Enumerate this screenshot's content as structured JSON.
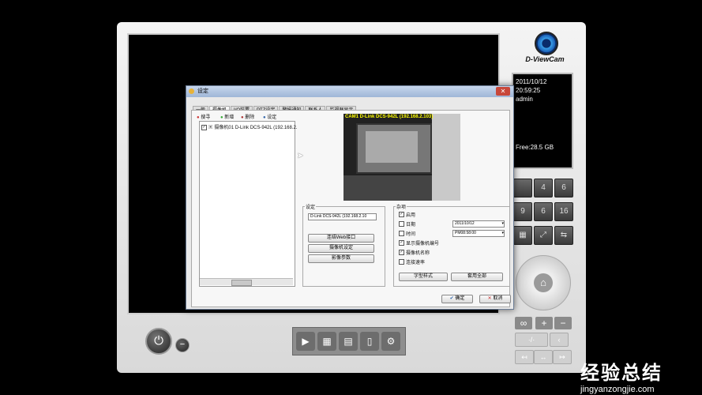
{
  "app": {
    "logo_text": "D-ViewCam",
    "info": {
      "date": "2011/10/12",
      "time": "20:59:25",
      "user": "admin",
      "free": "Free:28.5 GB"
    },
    "grid_buttons": [
      "4",
      "6",
      "9",
      "6",
      "16"
    ]
  },
  "dialog": {
    "title": "设定",
    "close": "✕",
    "tabs": [
      "一般",
      "摄像机",
      "I/O装置",
      "PTZ设定",
      "警报通知",
      "联系人",
      "监视器显示"
    ],
    "toolbar": [
      "搜寻",
      "新增",
      "删除",
      "设定"
    ],
    "camera_item": "摄像机01 D-Link DCS-942L (192.168.2.",
    "video_caption": "CAM1 D-Link DCS-942L (192.168.2.103)",
    "settings": {
      "legend": "设定",
      "device_value": "D-Link DCS-942L (192.168.2.10",
      "buttons": [
        "连结Web接口",
        "摄像机设定",
        "影像参数"
      ]
    },
    "misc": {
      "legend": "杂项",
      "enable": "启用",
      "date_label": "日期",
      "date_value": "2011/10/12",
      "time_label": "时间",
      "time_value": "PM08:58:00",
      "show_number": "显示摄像机编号",
      "show_name": "摄像机名称",
      "conn_rate": "连接速率",
      "font_button": "字型样式",
      "apply_all_button": "套用全部"
    },
    "ok": "确定",
    "cancel": "取消"
  },
  "watermark": {
    "line1": "经验总结",
    "line2": "jingyanzongjie.com"
  }
}
